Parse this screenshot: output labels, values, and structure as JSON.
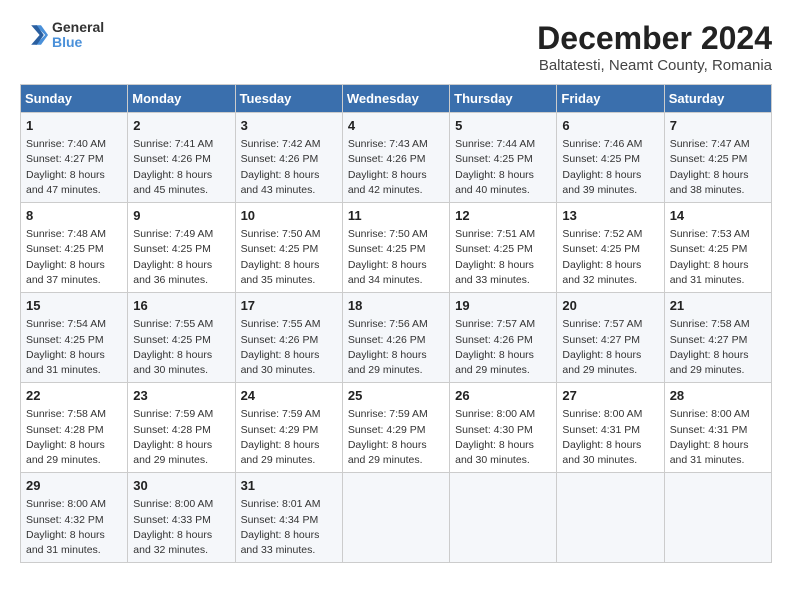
{
  "header": {
    "logo": {
      "line1": "General",
      "line2": "Blue"
    },
    "title": "December 2024",
    "subtitle": "Baltatesti, Neamt County, Romania"
  },
  "weekdays": [
    "Sunday",
    "Monday",
    "Tuesday",
    "Wednesday",
    "Thursday",
    "Friday",
    "Saturday"
  ],
  "weeks": [
    [
      {
        "day": 1,
        "info": "Sunrise: 7:40 AM\nSunset: 4:27 PM\nDaylight: 8 hours\nand 47 minutes."
      },
      {
        "day": 2,
        "info": "Sunrise: 7:41 AM\nSunset: 4:26 PM\nDaylight: 8 hours\nand 45 minutes."
      },
      {
        "day": 3,
        "info": "Sunrise: 7:42 AM\nSunset: 4:26 PM\nDaylight: 8 hours\nand 43 minutes."
      },
      {
        "day": 4,
        "info": "Sunrise: 7:43 AM\nSunset: 4:26 PM\nDaylight: 8 hours\nand 42 minutes."
      },
      {
        "day": 5,
        "info": "Sunrise: 7:44 AM\nSunset: 4:25 PM\nDaylight: 8 hours\nand 40 minutes."
      },
      {
        "day": 6,
        "info": "Sunrise: 7:46 AM\nSunset: 4:25 PM\nDaylight: 8 hours\nand 39 minutes."
      },
      {
        "day": 7,
        "info": "Sunrise: 7:47 AM\nSunset: 4:25 PM\nDaylight: 8 hours\nand 38 minutes."
      }
    ],
    [
      {
        "day": 8,
        "info": "Sunrise: 7:48 AM\nSunset: 4:25 PM\nDaylight: 8 hours\nand 37 minutes."
      },
      {
        "day": 9,
        "info": "Sunrise: 7:49 AM\nSunset: 4:25 PM\nDaylight: 8 hours\nand 36 minutes."
      },
      {
        "day": 10,
        "info": "Sunrise: 7:50 AM\nSunset: 4:25 PM\nDaylight: 8 hours\nand 35 minutes."
      },
      {
        "day": 11,
        "info": "Sunrise: 7:50 AM\nSunset: 4:25 PM\nDaylight: 8 hours\nand 34 minutes."
      },
      {
        "day": 12,
        "info": "Sunrise: 7:51 AM\nSunset: 4:25 PM\nDaylight: 8 hours\nand 33 minutes."
      },
      {
        "day": 13,
        "info": "Sunrise: 7:52 AM\nSunset: 4:25 PM\nDaylight: 8 hours\nand 32 minutes."
      },
      {
        "day": 14,
        "info": "Sunrise: 7:53 AM\nSunset: 4:25 PM\nDaylight: 8 hours\nand 31 minutes."
      }
    ],
    [
      {
        "day": 15,
        "info": "Sunrise: 7:54 AM\nSunset: 4:25 PM\nDaylight: 8 hours\nand 31 minutes."
      },
      {
        "day": 16,
        "info": "Sunrise: 7:55 AM\nSunset: 4:25 PM\nDaylight: 8 hours\nand 30 minutes."
      },
      {
        "day": 17,
        "info": "Sunrise: 7:55 AM\nSunset: 4:26 PM\nDaylight: 8 hours\nand 30 minutes."
      },
      {
        "day": 18,
        "info": "Sunrise: 7:56 AM\nSunset: 4:26 PM\nDaylight: 8 hours\nand 29 minutes."
      },
      {
        "day": 19,
        "info": "Sunrise: 7:57 AM\nSunset: 4:26 PM\nDaylight: 8 hours\nand 29 minutes."
      },
      {
        "day": 20,
        "info": "Sunrise: 7:57 AM\nSunset: 4:27 PM\nDaylight: 8 hours\nand 29 minutes."
      },
      {
        "day": 21,
        "info": "Sunrise: 7:58 AM\nSunset: 4:27 PM\nDaylight: 8 hours\nand 29 minutes."
      }
    ],
    [
      {
        "day": 22,
        "info": "Sunrise: 7:58 AM\nSunset: 4:28 PM\nDaylight: 8 hours\nand 29 minutes."
      },
      {
        "day": 23,
        "info": "Sunrise: 7:59 AM\nSunset: 4:28 PM\nDaylight: 8 hours\nand 29 minutes."
      },
      {
        "day": 24,
        "info": "Sunrise: 7:59 AM\nSunset: 4:29 PM\nDaylight: 8 hours\nand 29 minutes."
      },
      {
        "day": 25,
        "info": "Sunrise: 7:59 AM\nSunset: 4:29 PM\nDaylight: 8 hours\nand 29 minutes."
      },
      {
        "day": 26,
        "info": "Sunrise: 8:00 AM\nSunset: 4:30 PM\nDaylight: 8 hours\nand 30 minutes."
      },
      {
        "day": 27,
        "info": "Sunrise: 8:00 AM\nSunset: 4:31 PM\nDaylight: 8 hours\nand 30 minutes."
      },
      {
        "day": 28,
        "info": "Sunrise: 8:00 AM\nSunset: 4:31 PM\nDaylight: 8 hours\nand 31 minutes."
      }
    ],
    [
      {
        "day": 29,
        "info": "Sunrise: 8:00 AM\nSunset: 4:32 PM\nDaylight: 8 hours\nand 31 minutes."
      },
      {
        "day": 30,
        "info": "Sunrise: 8:00 AM\nSunset: 4:33 PM\nDaylight: 8 hours\nand 32 minutes."
      },
      {
        "day": 31,
        "info": "Sunrise: 8:01 AM\nSunset: 4:34 PM\nDaylight: 8 hours\nand 33 minutes."
      },
      null,
      null,
      null,
      null
    ]
  ]
}
